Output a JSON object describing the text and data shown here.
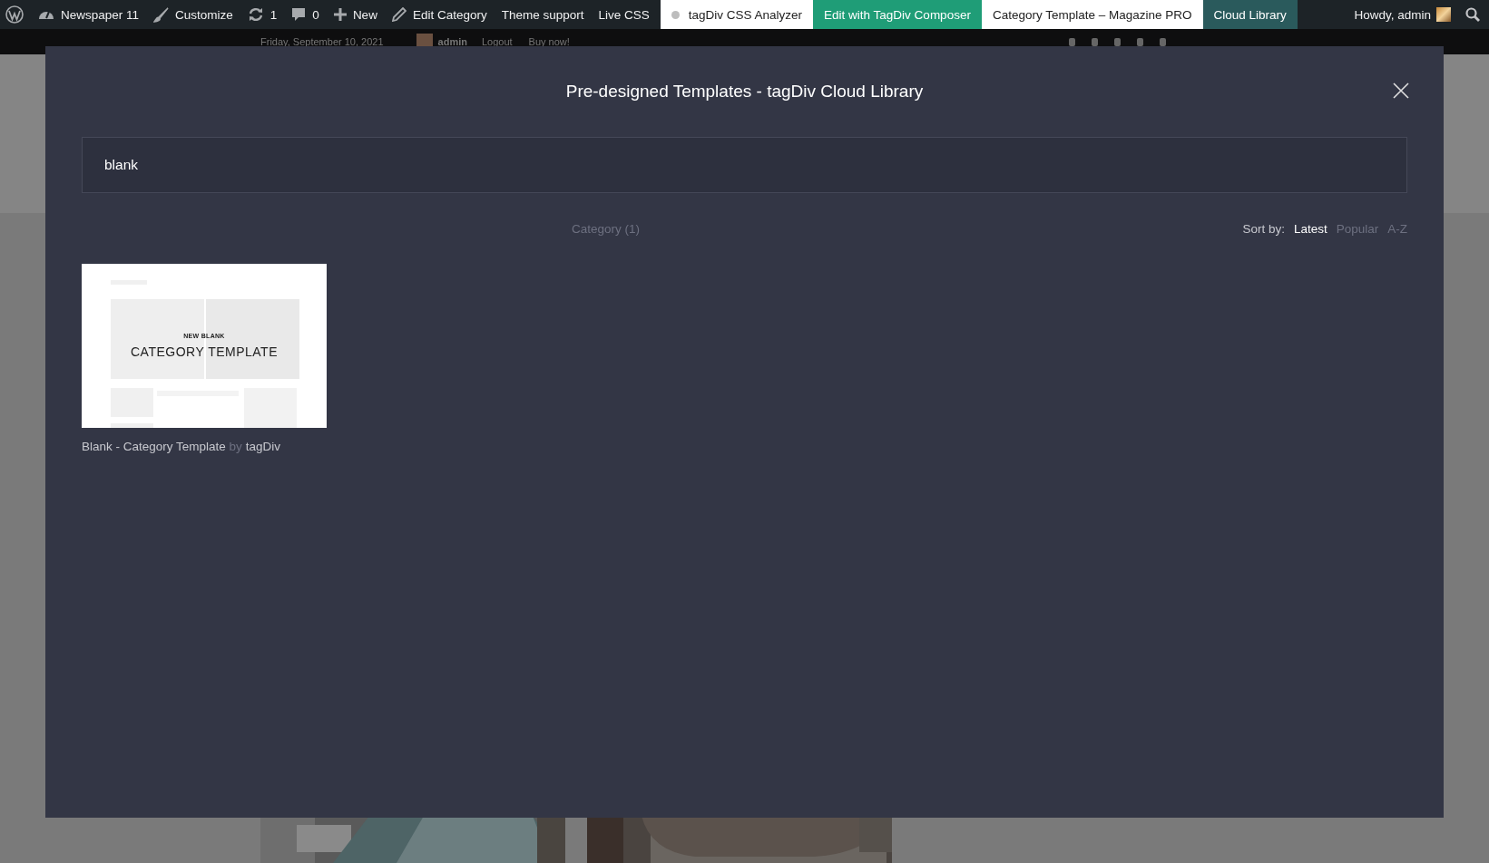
{
  "admin_bar": {
    "items": [
      {
        "kind": "wordpress"
      },
      {
        "kind": "site",
        "label": "Newspaper 11"
      },
      {
        "kind": "customize",
        "label": "Customize"
      },
      {
        "kind": "updates",
        "label": "1"
      },
      {
        "kind": "comments",
        "label": "0"
      },
      {
        "kind": "new",
        "label": "New"
      },
      {
        "kind": "edit",
        "label": "Edit Category"
      },
      {
        "kind": "link",
        "label": "Theme support"
      },
      {
        "kind": "link",
        "label": "Live CSS"
      },
      {
        "kind": "analyzer",
        "label": "tagDiv CSS Analyzer"
      },
      {
        "kind": "composer",
        "label": "Edit with TagDiv Composer"
      },
      {
        "kind": "template",
        "label": "Category Template – Magazine PRO"
      },
      {
        "kind": "cloud",
        "label": "Cloud Library"
      }
    ],
    "greeting": "Howdy, admin"
  },
  "top_bar": {
    "date": "Friday, September 10, 2021",
    "user": "admin",
    "logout": "Logout",
    "buy": "Buy now!"
  },
  "modal": {
    "title": "Pre-designed Templates - tagDiv Cloud Library",
    "search": {
      "value": "blank"
    },
    "filter": {
      "label": "Category",
      "count": "(1)"
    },
    "sort": {
      "label": "Sort by:",
      "options": [
        {
          "label": "Latest",
          "selected": true
        },
        {
          "label": "Popular",
          "selected": false
        },
        {
          "label": "A-Z",
          "selected": false
        }
      ]
    },
    "templates": [
      {
        "preview_heading": "NEW BLANK",
        "preview_title": "CATEGORY TEMPLATE",
        "name": "Blank - Category Template",
        "by": "by",
        "author": "tagDiv"
      }
    ]
  }
}
